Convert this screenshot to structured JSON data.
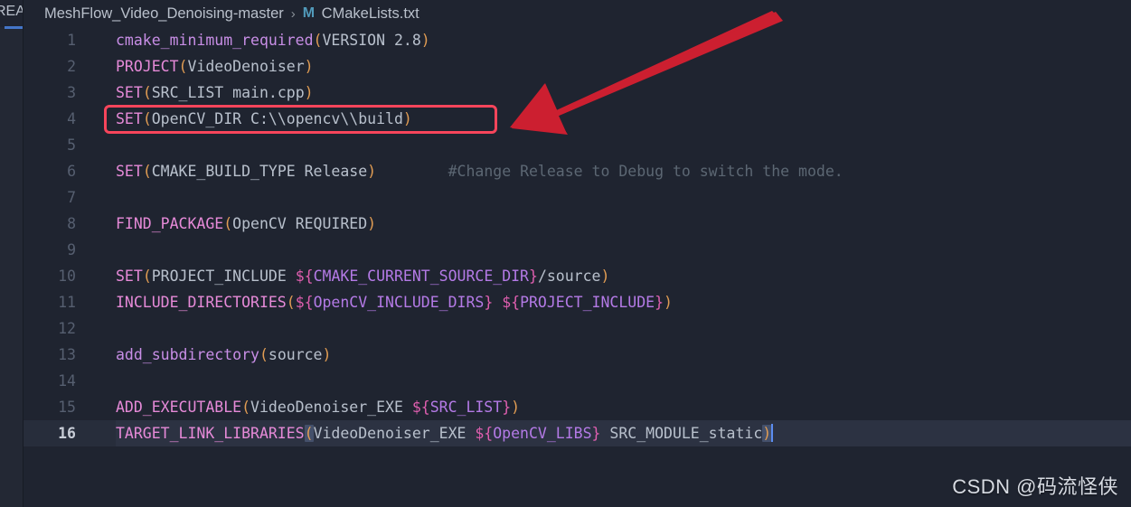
{
  "window": {
    "background_color": "#1f2430",
    "editor_background": "#1f2430"
  },
  "tab_strip": {
    "partial_tab_label": "REA",
    "active_underline_color": "#4476c9"
  },
  "breadcrumb": {
    "folder": "MeshFlow_Video_Denoising-master",
    "separator": "›",
    "file_icon_letter": "M",
    "file_icon_color": "#519aba",
    "file": "CMakeLists.txt"
  },
  "editor": {
    "language": "cmake",
    "active_line_number": 16,
    "cursor_line": 16,
    "cursor_column": 76,
    "lines": [
      {
        "number": "1",
        "tokens": [
          {
            "t": "cmake_minimum_required",
            "c": "t-cmd"
          },
          {
            "t": "(",
            "c": "t-paren"
          },
          {
            "t": "VERSION 2.8",
            "c": "t-arg"
          },
          {
            "t": ")",
            "c": "t-paren"
          }
        ]
      },
      {
        "number": "2",
        "tokens": [
          {
            "t": "PROJECT",
            "c": "t-cmd2"
          },
          {
            "t": "(",
            "c": "t-paren"
          },
          {
            "t": "VideoDenoiser",
            "c": "t-arg"
          },
          {
            "t": ")",
            "c": "t-paren"
          }
        ]
      },
      {
        "number": "3",
        "tokens": [
          {
            "t": "SET",
            "c": "t-cmd2"
          },
          {
            "t": "(",
            "c": "t-paren"
          },
          {
            "t": "SRC_LIST main.cpp",
            "c": "t-arg"
          },
          {
            "t": ")",
            "c": "t-paren"
          }
        ]
      },
      {
        "number": "4",
        "tokens": [
          {
            "t": "SET",
            "c": "t-cmd2"
          },
          {
            "t": "(",
            "c": "t-paren"
          },
          {
            "t": "OpenCV_DIR C:\\\\opencv\\\\build",
            "c": "t-arg"
          },
          {
            "t": ")",
            "c": "t-paren"
          }
        ]
      },
      {
        "number": "5",
        "tokens": []
      },
      {
        "number": "6",
        "tokens": [
          {
            "t": "SET",
            "c": "t-cmd2"
          },
          {
            "t": "(",
            "c": "t-paren"
          },
          {
            "t": "CMAKE_BUILD_TYPE Release",
            "c": "t-arg"
          },
          {
            "t": ")",
            "c": "t-paren"
          },
          {
            "t": "        ",
            "c": "t-arg"
          },
          {
            "t": "#Change Release to Debug to switch the mode.",
            "c": "t-comment"
          }
        ]
      },
      {
        "number": "7",
        "tokens": []
      },
      {
        "number": "8",
        "tokens": [
          {
            "t": "FIND_PACKAGE",
            "c": "t-cmd2"
          },
          {
            "t": "(",
            "c": "t-paren"
          },
          {
            "t": "OpenCV REQUIRED",
            "c": "t-arg"
          },
          {
            "t": ")",
            "c": "t-paren"
          }
        ]
      },
      {
        "number": "9",
        "tokens": []
      },
      {
        "number": "10",
        "tokens": [
          {
            "t": "SET",
            "c": "t-cmd2"
          },
          {
            "t": "(",
            "c": "t-paren"
          },
          {
            "t": "PROJECT_INCLUDE ",
            "c": "t-arg"
          },
          {
            "t": "${",
            "c": "t-varb"
          },
          {
            "t": "CMAKE_CURRENT_SOURCE_DIR",
            "c": "t-var"
          },
          {
            "t": "}",
            "c": "t-varb"
          },
          {
            "t": "/source",
            "c": "t-arg"
          },
          {
            "t": ")",
            "c": "t-paren"
          }
        ]
      },
      {
        "number": "11",
        "tokens": [
          {
            "t": "INCLUDE_DIRECTORIES",
            "c": "t-cmd2"
          },
          {
            "t": "(",
            "c": "t-paren"
          },
          {
            "t": "${",
            "c": "t-varb"
          },
          {
            "t": "OpenCV_INCLUDE_DIRS",
            "c": "t-var"
          },
          {
            "t": "}",
            "c": "t-varb"
          },
          {
            "t": " ",
            "c": "t-arg"
          },
          {
            "t": "${",
            "c": "t-varb"
          },
          {
            "t": "PROJECT_INCLUDE",
            "c": "t-var"
          },
          {
            "t": "}",
            "c": "t-varb"
          },
          {
            "t": ")",
            "c": "t-paren"
          }
        ]
      },
      {
        "number": "12",
        "tokens": []
      },
      {
        "number": "13",
        "tokens": [
          {
            "t": "add_subdirectory",
            "c": "t-cmd"
          },
          {
            "t": "(",
            "c": "t-paren"
          },
          {
            "t": "source",
            "c": "t-arg"
          },
          {
            "t": ")",
            "c": "t-paren"
          }
        ]
      },
      {
        "number": "14",
        "tokens": []
      },
      {
        "number": "15",
        "tokens": [
          {
            "t": "ADD_EXECUTABLE",
            "c": "t-cmd2"
          },
          {
            "t": "(",
            "c": "t-paren"
          },
          {
            "t": "VideoDenoiser_EXE ",
            "c": "t-arg"
          },
          {
            "t": "${",
            "c": "t-varb"
          },
          {
            "t": "SRC_LIST",
            "c": "t-var"
          },
          {
            "t": "}",
            "c": "t-varb"
          },
          {
            "t": ")",
            "c": "t-paren"
          }
        ]
      },
      {
        "number": "16",
        "active": true,
        "tokens": [
          {
            "t": "TARGET_LINK_LIBRARIES",
            "c": "t-cmd2"
          },
          {
            "t": "(",
            "c": "t-paren",
            "match": true
          },
          {
            "t": "VideoDenoiser_EXE ",
            "c": "t-arg"
          },
          {
            "t": "${",
            "c": "t-varb"
          },
          {
            "t": "OpenCV_LIBS",
            "c": "t-var"
          },
          {
            "t": "}",
            "c": "t-varb"
          },
          {
            "t": " SRC_MODULE_static",
            "c": "t-arg"
          },
          {
            "t": ")",
            "c": "t-paren",
            "match": true
          }
        ],
        "cursor_after": true
      }
    ]
  },
  "annotations": {
    "highlight_box": {
      "target_line": 4,
      "target_text": "SET(OpenCV_DIR C:\\\\opencv\\\\build)",
      "color": "#f7455b"
    },
    "arrow": {
      "color": "#cc1f30",
      "points_to": "highlight-box",
      "direction": "down-left"
    }
  },
  "watermark": {
    "text": "CSDN @码流怪侠"
  }
}
